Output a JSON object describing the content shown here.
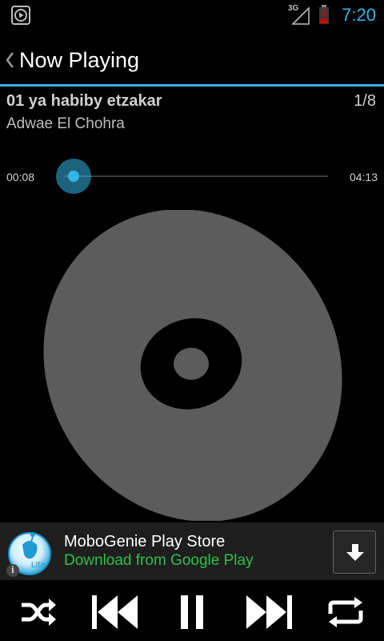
{
  "status_bar": {
    "network_label": "3G",
    "time": "7:20",
    "accent_color": "#33b5e5",
    "battery_color": "#cc0000"
  },
  "action_bar": {
    "title": "Now Playing",
    "back_icon": "chevron-left-icon"
  },
  "track": {
    "title": "01 ya habiby etzakar",
    "index": "1/8",
    "artist": "Adwae El Chohra"
  },
  "seek": {
    "elapsed": "00:08",
    "total": "04:13",
    "progress": 0.032
  },
  "album_art": {
    "icon": "disc-icon"
  },
  "ad": {
    "title": "MoboGenie Play Store",
    "subtitle": "Download from Google Play",
    "logo_label": "Lite",
    "info_glyph": "i",
    "subtitle_color": "#2fbf4a",
    "download_icon": "download-arrow-icon"
  },
  "controls": {
    "shuffle_icon": "shuffle-icon",
    "prev_icon": "skip-previous-icon",
    "pause_icon": "pause-icon",
    "next_icon": "skip-next-icon",
    "repeat_icon": "repeat-icon"
  }
}
